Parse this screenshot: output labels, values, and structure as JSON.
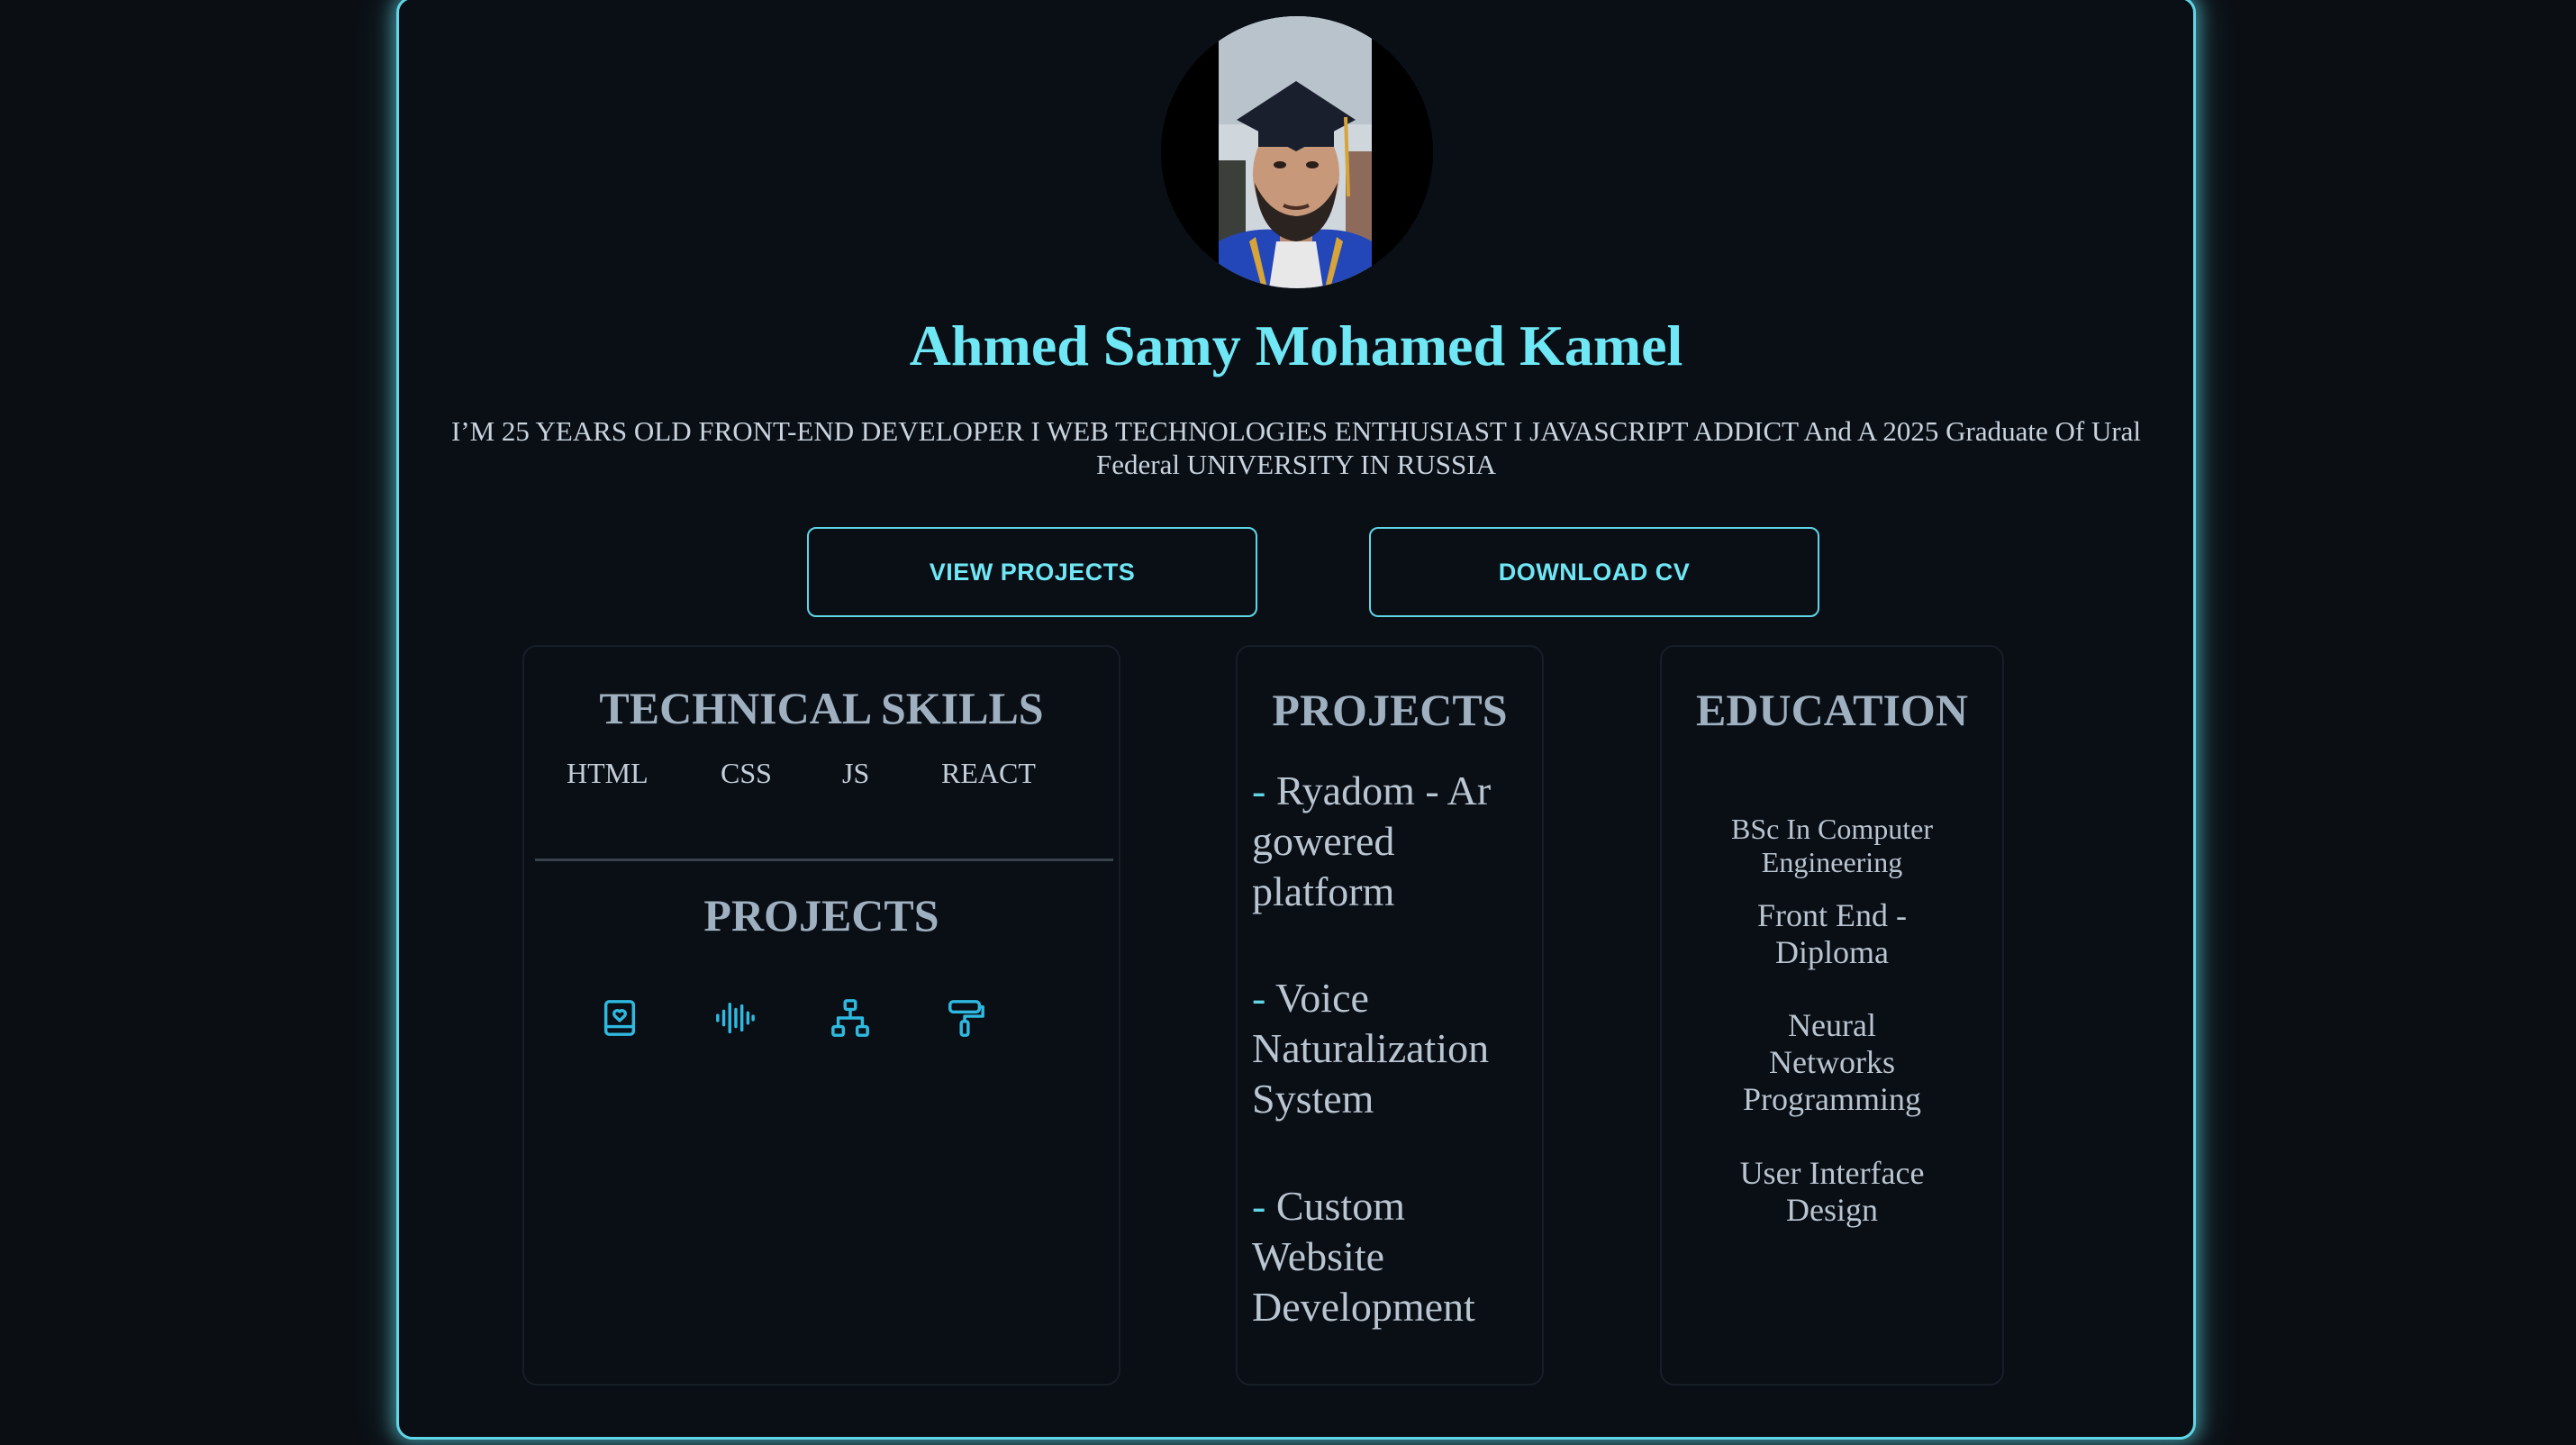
{
  "profile": {
    "name": "Ahmed Samy Mohamed Kamel",
    "bio": "I’M 25 YEARS OLD FRONT-END DEVELOPER I WEB TECHNOLOGIES ENTHUSIAST I JAVASCRIPT ADDICT And A 2025 Graduate Of Ural Federal UNIVERSITY IN RUSSIA",
    "avatar_alt": "avatar-photo"
  },
  "buttons": {
    "view_projects": "VIEW PROJECTS",
    "download_cv": "DOWNLOAD CV"
  },
  "skills_card": {
    "title": "TECHNICAL SKILLS",
    "skills": [
      "HTML",
      "CSS",
      "JS",
      "REACT"
    ],
    "projects_title": "PROJECTS",
    "project_icons": [
      "book-heart-icon",
      "audio-wave-icon",
      "sitemap-icon",
      "paint-roller-icon"
    ]
  },
  "projects_card": {
    "title": "PROJECTS",
    "items": [
      {
        "dash": "-",
        "text": " Ryadom - Ar gowered platform"
      },
      {
        "dash": "-",
        "text": " Voice Naturalization System"
      },
      {
        "dash": "-",
        "text": " Custom Website Development"
      }
    ]
  },
  "education_card": {
    "title": "EDUCATION",
    "items": [
      "BSc In Computer Engineering",
      "Front End - Diploma",
      "Neural Networks Programming",
      "User Interface Design"
    ]
  },
  "colors": {
    "accent": "#6fe7f5",
    "frame_glow": "#5fd6e6",
    "icon": "#2fb9e0",
    "background": "#0b0f14"
  }
}
